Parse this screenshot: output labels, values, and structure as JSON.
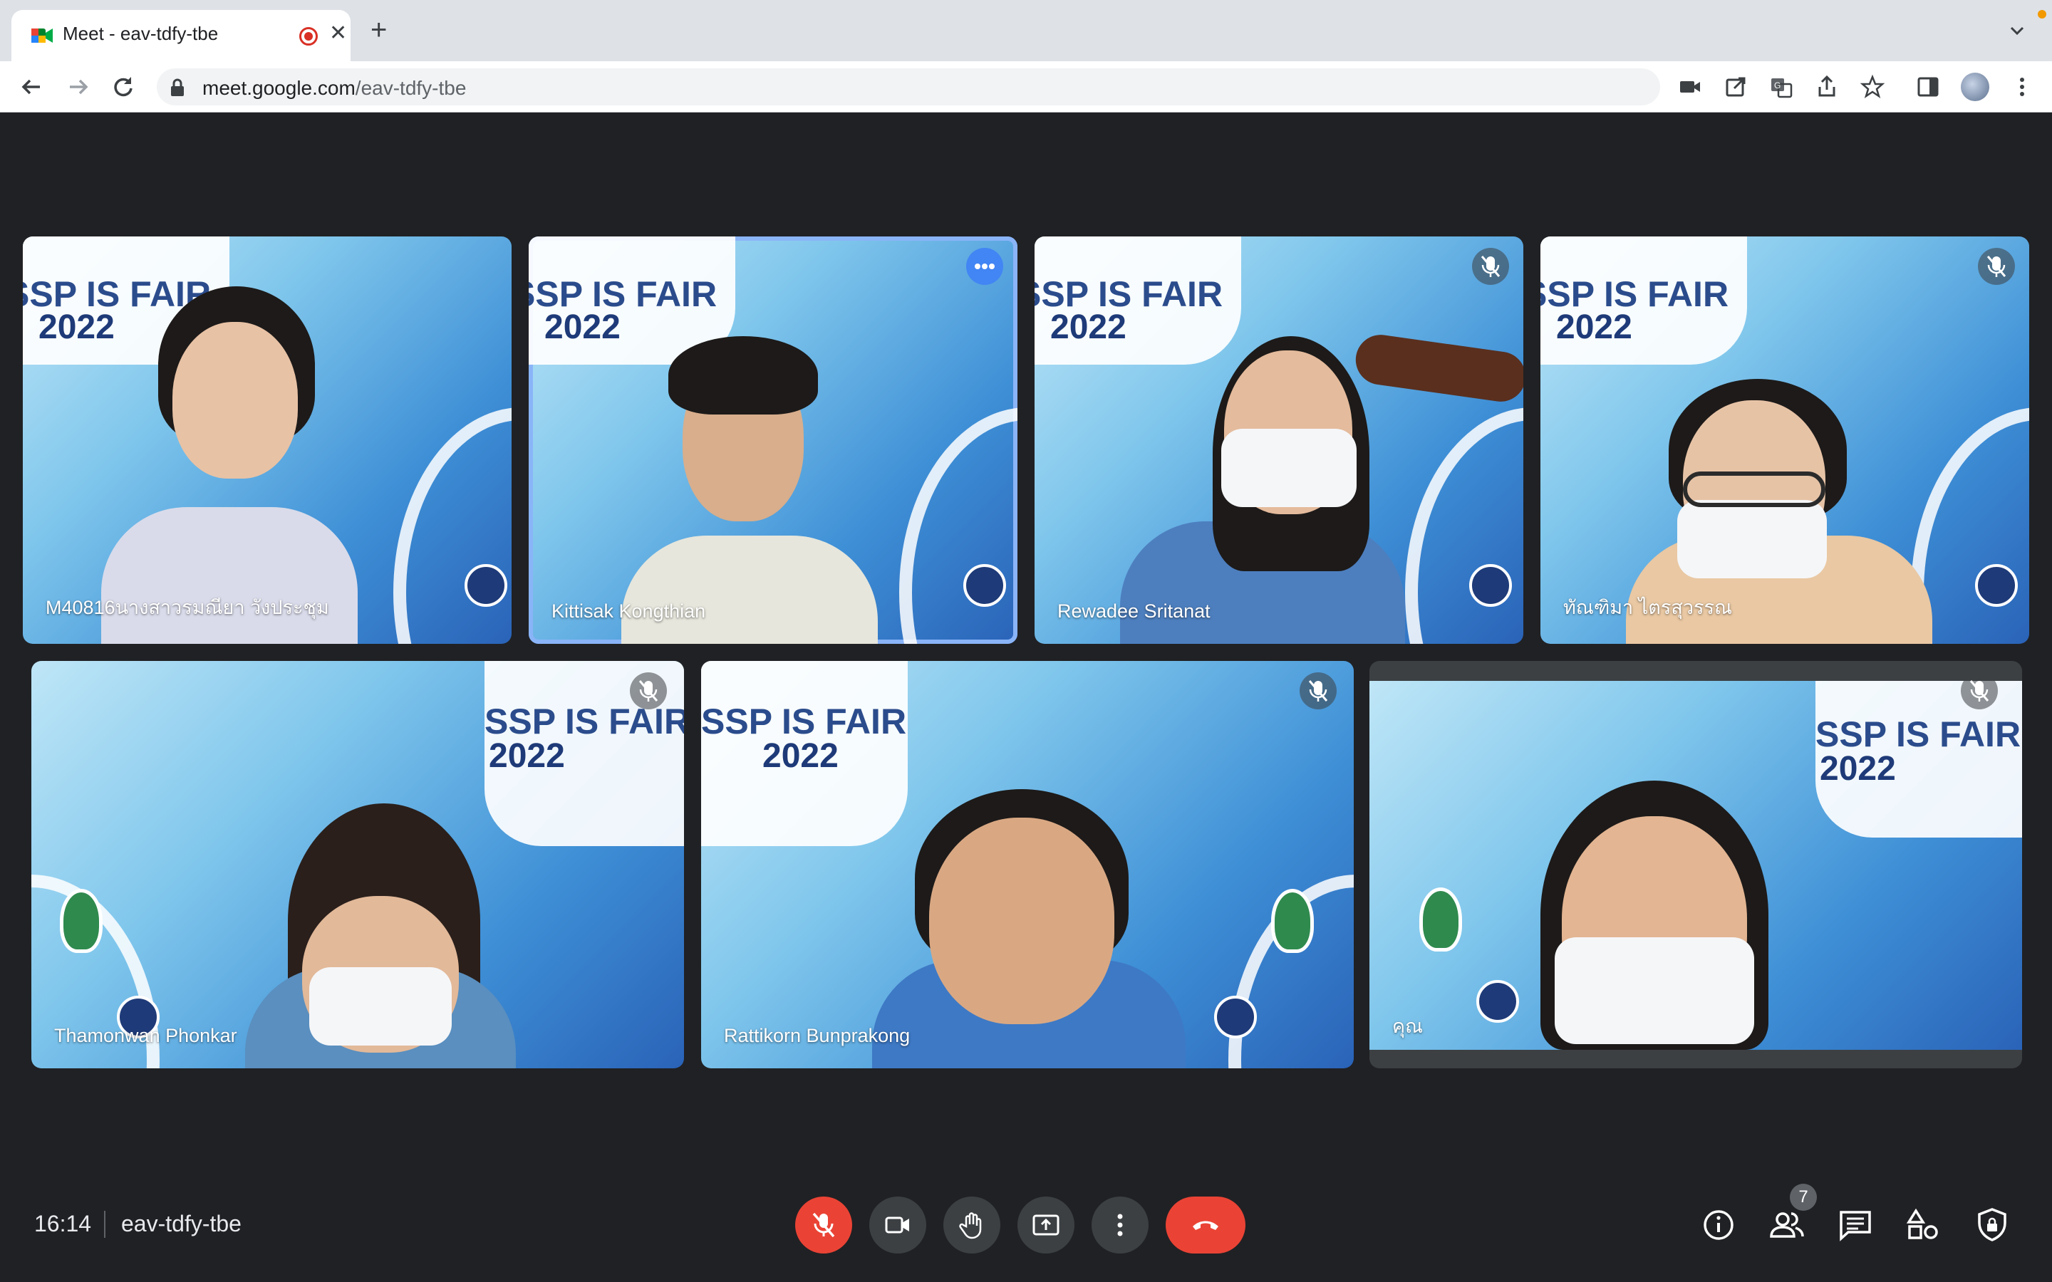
{
  "browser": {
    "tab_title": "Meet - eav-tdfy-tbe",
    "close_glyph": "✕",
    "new_tab_glyph": "+",
    "url_host": "meet.google.com",
    "url_path": "/eav-tdfy-tbe"
  },
  "meeting": {
    "time": "16:14",
    "code": "eav-tdfy-tbe",
    "participant_count": "7"
  },
  "participants": [
    {
      "name": "M40816นางสาวรมณียา วังประชุม",
      "muted": false
    },
    {
      "name": "Kittisak Kongthian",
      "muted": false,
      "active": true
    },
    {
      "name": "Rewadee Sritanat",
      "muted": true
    },
    {
      "name": "ทัณฑิมา ไตรสุวรรณ",
      "muted": true
    },
    {
      "name": "Thamonwan Phonkar",
      "muted": true
    },
    {
      "name": "Rattikorn Bunprakong",
      "muted": true
    },
    {
      "name": "คุณ",
      "muted": true
    }
  ],
  "backdrop": {
    "title": "SSP IS FAIR",
    "year": "2022"
  },
  "colors": {
    "stage_bg": "#202124",
    "control_bg": "#3c4043",
    "danger": "#ea4335",
    "active_outline": "#8ab4f8",
    "accent_blue": "#4285f4"
  },
  "icons": {
    "controls": [
      "mic-off-icon",
      "videocam-icon",
      "raise-hand-icon",
      "present-icon",
      "more-vert-icon",
      "call-end-icon"
    ],
    "right": [
      "info-icon",
      "people-icon",
      "chat-icon",
      "activities-icon",
      "host-controls-icon"
    ]
  }
}
